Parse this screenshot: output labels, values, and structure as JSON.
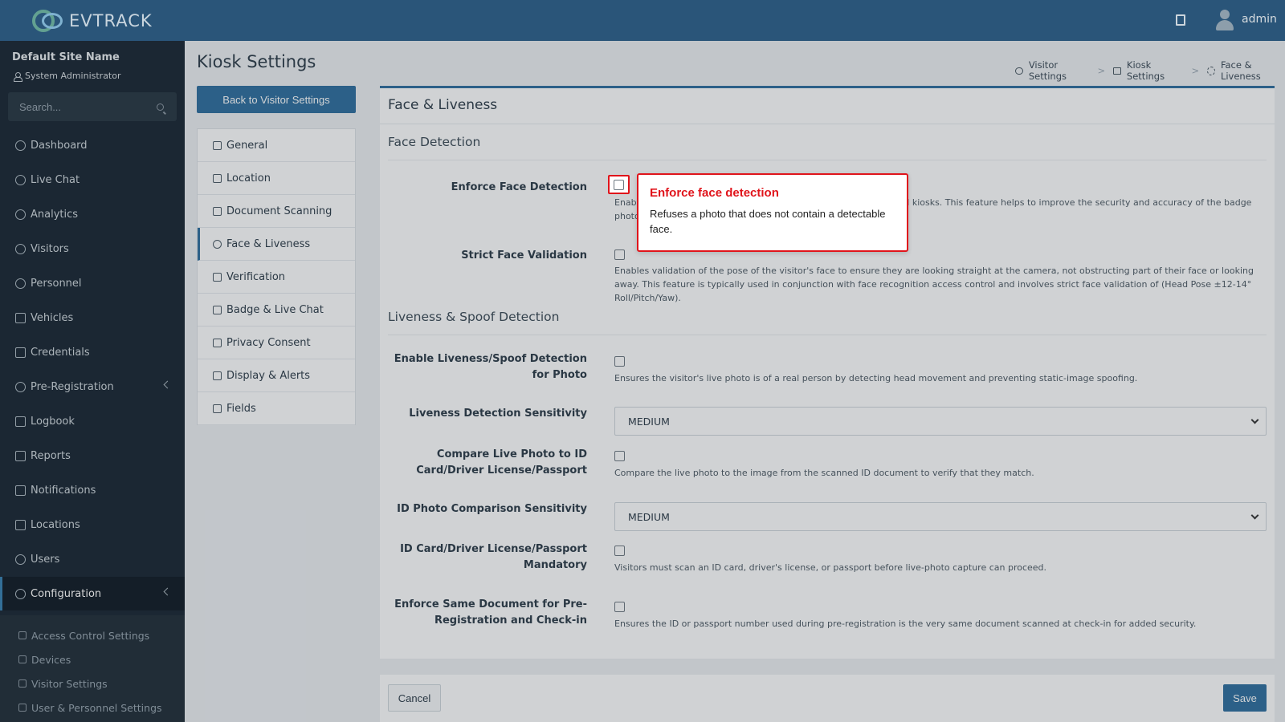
{
  "header": {
    "brand": "EVTRACK",
    "user": "admin"
  },
  "sidebar": {
    "site_name": "Default Site Name",
    "role": "System Administrator",
    "search_placeholder": "Search...",
    "items": [
      {
        "label": "Dashboard",
        "icon": "dashboard-icon"
      },
      {
        "label": "Live Chat",
        "icon": "headset-icon"
      },
      {
        "label": "Analytics",
        "icon": "analytics-icon"
      },
      {
        "label": "Visitors",
        "icon": "eye-icon"
      },
      {
        "label": "Personnel",
        "icon": "personnel-icon"
      },
      {
        "label": "Vehicles",
        "icon": "car-icon"
      },
      {
        "label": "Credentials",
        "icon": "credentials-icon"
      },
      {
        "label": "Pre-Registration",
        "icon": "arrows-icon"
      },
      {
        "label": "Logbook",
        "icon": "book-icon"
      },
      {
        "label": "Reports",
        "icon": "reports-icon"
      },
      {
        "label": "Notifications",
        "icon": "notifications-icon"
      },
      {
        "label": "Locations",
        "icon": "building-icon"
      },
      {
        "label": "Users",
        "icon": "users-icon"
      },
      {
        "label": "Configuration",
        "icon": "gear-icon"
      }
    ],
    "sub_items": [
      {
        "label": "Access Control Settings",
        "icon": "lock-icon"
      },
      {
        "label": "Devices",
        "icon": "devices-icon"
      },
      {
        "label": "Visitor Settings",
        "icon": "eye-icon"
      },
      {
        "label": "User & Personnel Settings",
        "icon": "user-settings-icon"
      }
    ]
  },
  "page": {
    "title": "Kiosk Settings",
    "back_button": "Back to Visitor Settings",
    "breadcrumb": [
      "Visitor Settings",
      "Kiosk Settings",
      "Face & Liveness"
    ]
  },
  "subnav": [
    {
      "label": "General",
      "icon": "sliders-icon"
    },
    {
      "label": "Location",
      "icon": "location-pin-icon"
    },
    {
      "label": "Document Scanning",
      "icon": "scan-icon"
    },
    {
      "label": "Face & Liveness",
      "icon": "face-icon"
    },
    {
      "label": "Verification",
      "icon": "shield-check-icon"
    },
    {
      "label": "Badge & Live Chat",
      "icon": "badge-icon"
    },
    {
      "label": "Privacy Consent",
      "icon": "privacy-icon"
    },
    {
      "label": "Display & Alerts",
      "icon": "display-icon"
    },
    {
      "label": "Fields",
      "icon": "list-check-icon"
    }
  ],
  "card": {
    "title": "Face & Liveness",
    "sections": {
      "face_detection": "Face Detection",
      "liveness": "Liveness & Spoof Detection"
    },
    "fields": {
      "enforce_face": {
        "label": "Enforce Face Detection",
        "help_left": "Enabl",
        "help_right": "n all kiosks. This feature helps to improve the security and accuracy of the badge",
        "help_line2": "photo"
      },
      "strict_face": {
        "label": "Strict Face Validation",
        "help": "Enables validation of the pose of the visitor's face to ensure they are looking straight at the camera, not obstructing part of their face or looking away. This feature is typically used in conjunction with face recognition access control and involves strict face validation of (Head Pose ±12-14° Roll/Pitch/Yaw)."
      },
      "liveness_enable": {
        "label": "Enable Liveness/Spoof Detection for Photo",
        "help": "Ensures the visitor's live photo is of a real person by detecting head movement and preventing static-image spoofing."
      },
      "liveness_sensitivity": {
        "label": "Liveness Detection Sensitivity",
        "value": "MEDIUM"
      },
      "compare_id": {
        "label": "Compare Live Photo to ID Card/Driver License/Passport",
        "help": "Compare the live photo to the image from the scanned ID document to verify that they match."
      },
      "id_sensitivity": {
        "label": "ID Photo Comparison Sensitivity",
        "value": "MEDIUM"
      },
      "id_mandatory": {
        "label": "ID Card/Driver License/Passport Mandatory",
        "help": "Visitors must scan an ID card, driver's license, or passport before live-photo capture can proceed."
      },
      "same_doc": {
        "label": "Enforce Same Document for Pre-Registration and Check-in",
        "help": "Ensures the ID or passport number used during pre-registration is the very same document scanned at check-in for added security."
      }
    }
  },
  "footer": {
    "cancel": "Cancel",
    "save": "Save"
  },
  "tooltip": {
    "title": "Enforce face detection",
    "body": "Refuses a photo that does not contain a detectable face."
  }
}
